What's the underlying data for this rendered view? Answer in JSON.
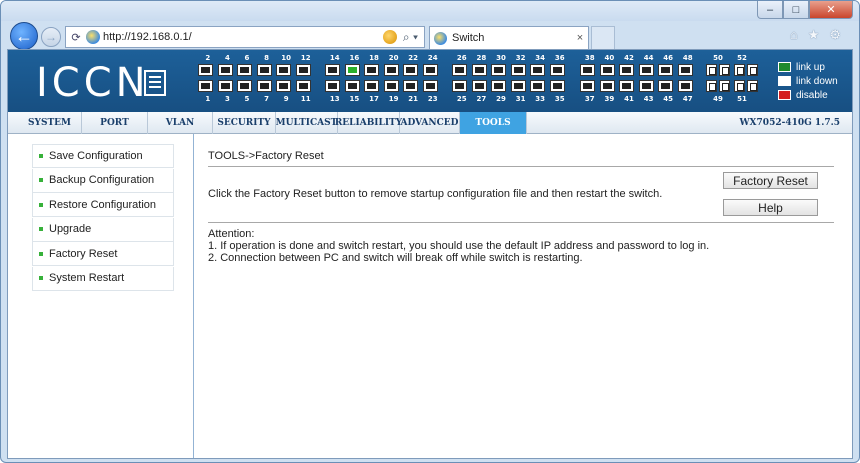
{
  "browser": {
    "url": "http://192.168.0.1/",
    "tab_title": "Switch",
    "tab_close": "×",
    "back_glyph": "←",
    "forward_glyph": "→",
    "refresh_glyph": "↻",
    "search_glyph": "⌕ ▾",
    "toolbar_icons": [
      "home-icon",
      "favorites-star-icon",
      "settings-gear-icon"
    ],
    "window_controls": {
      "minimize": "–",
      "maximize": "□",
      "close": "✕"
    }
  },
  "switch_header": {
    "brand": "ICCN",
    "ports_top": [
      "2",
      "4",
      "6",
      "8",
      "10",
      "12",
      "14",
      "16",
      "18",
      "20",
      "22",
      "24",
      "26",
      "28",
      "30",
      "32",
      "34",
      "36",
      "38",
      "40",
      "42",
      "44",
      "46",
      "48"
    ],
    "ports_bottom": [
      "1",
      "3",
      "5",
      "7",
      "9",
      "11",
      "13",
      "15",
      "17",
      "19",
      "21",
      "23",
      "25",
      "27",
      "29",
      "31",
      "33",
      "35",
      "37",
      "39",
      "41",
      "43",
      "45",
      "47"
    ],
    "port_up": "16",
    "sfp_top": [
      "50",
      "52"
    ],
    "sfp_bottom": [
      "49",
      "51"
    ],
    "legend": [
      {
        "label": "link up",
        "color": "#1f8a2e"
      },
      {
        "label": "link down",
        "color": "#ffffff"
      },
      {
        "label": "disable",
        "color": "#d42020"
      }
    ]
  },
  "menu": {
    "items": [
      "SYSTEM",
      "PORT",
      "VLAN",
      "SECURITY",
      "MULTICAST",
      "RELIABILITY",
      "ADVANCED",
      "TOOLS"
    ],
    "active": "TOOLS",
    "version": "WX7052-410G 1.7.5"
  },
  "sidebar": {
    "items": [
      "Save Configuration",
      "Backup Configuration",
      "Restore Configuration",
      "Upgrade",
      "Factory Reset",
      "System Restart"
    ]
  },
  "main": {
    "breadcrumb": "TOOLS->Factory Reset",
    "description": "Click the Factory Reset button to remove startup configuration file and then restart the switch.",
    "factory_reset_button": "Factory Reset",
    "help_button": "Help",
    "attention_title": "Attention:",
    "attention_lines": [
      "1. If operation is done and switch restart, you should use the default IP address and password to log in.",
      "2. Connection between PC and switch will break off while switch is restarting."
    ]
  },
  "colors": {
    "header_blue": "#1b5b92",
    "active_tab": "#3fa3e2",
    "link_up": "#2bb12b",
    "bullet": "#37b13a"
  }
}
